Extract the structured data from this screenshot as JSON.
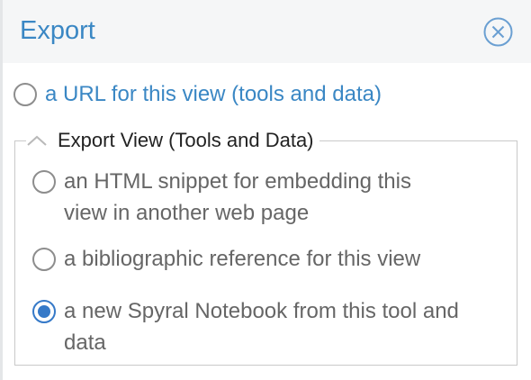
{
  "dialog": {
    "title": "Export",
    "close_icon": "close-circle-icon",
    "url_option": "a URL for this view (tools and data)",
    "fieldset": {
      "legend": "Export View (Tools and Data)",
      "toggle_icon": "chevron-up-icon",
      "options": [
        {
          "label_line1": "an HTML snippet for embedding this",
          "label_line2": "view in another web page",
          "checked": false
        },
        {
          "label_line1": "a bibliographic reference for this view",
          "checked": false
        },
        {
          "label_line1": "a new Spyral Notebook from this tool and",
          "label_line2": "data",
          "checked": true
        }
      ]
    }
  },
  "colors": {
    "accent": "#3a87c4",
    "radio_selected": "#3579c8"
  }
}
